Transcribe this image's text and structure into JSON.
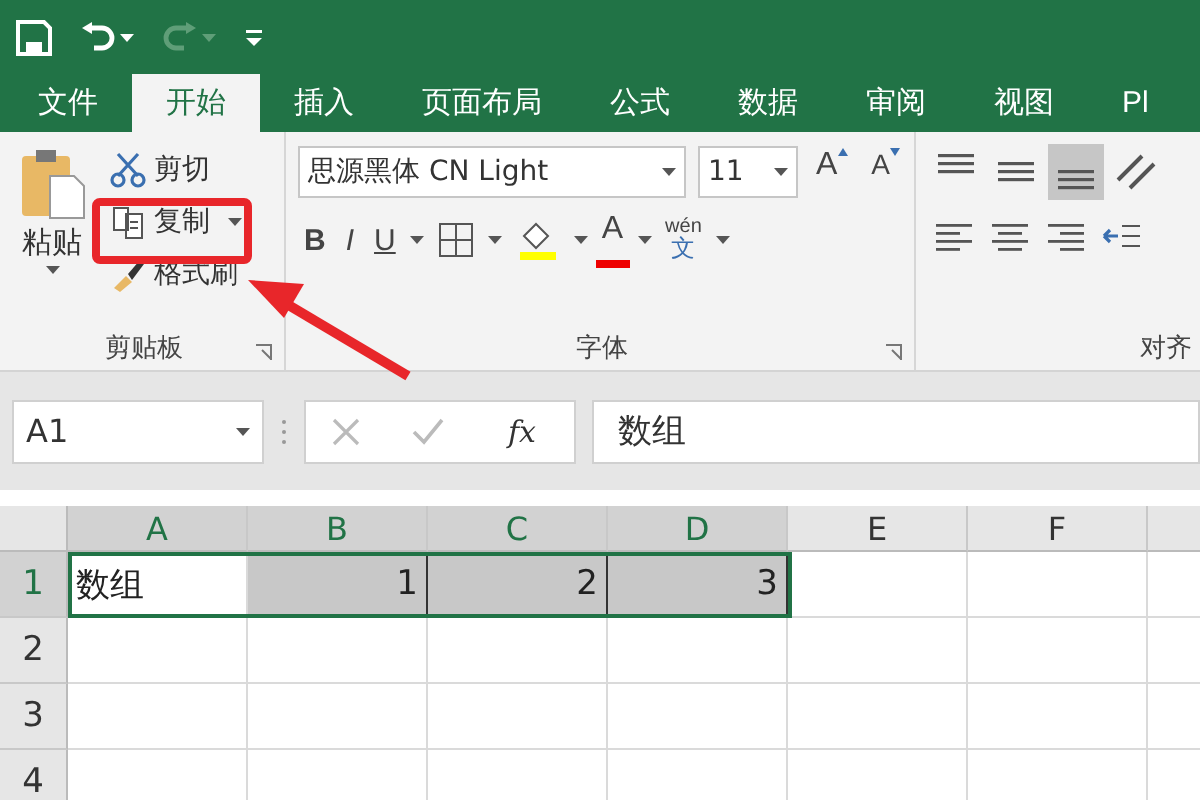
{
  "quick_access": [
    {
      "kind": "save",
      "disabled": false
    },
    {
      "kind": "undo",
      "disabled": false
    },
    {
      "kind": "redo",
      "disabled": true
    },
    {
      "kind": "customize",
      "disabled": false
    }
  ],
  "tabs": [
    {
      "label": "文件",
      "selected": false
    },
    {
      "label": "开始",
      "selected": true
    },
    {
      "label": "插入",
      "selected": false
    },
    {
      "label": "页面布局",
      "selected": false
    },
    {
      "label": "公式",
      "selected": false
    },
    {
      "label": "数据",
      "selected": false
    },
    {
      "label": "审阅",
      "selected": false
    },
    {
      "label": "视图",
      "selected": false
    },
    {
      "label": "Pl",
      "selected": false
    }
  ],
  "clipboard": {
    "title": "剪贴板",
    "paste": "粘贴",
    "cut": "剪切",
    "copy": "复制",
    "format_painter": "格式刷"
  },
  "font": {
    "title": "字体",
    "font_name": "思源黑体 CN Light",
    "font_size": "11",
    "grow": "A",
    "shrink": "A",
    "styles": [
      "B",
      "I",
      "U"
    ],
    "font_color": "A",
    "phonetic_top": "wén",
    "phonetic_char": "文"
  },
  "alignment": {
    "title": "对齐",
    "vertical": [
      {
        "kind": "top",
        "selected": false
      },
      {
        "kind": "middle",
        "selected": false
      },
      {
        "kind": "bottom",
        "selected": true
      }
    ]
  },
  "formula_bar": {
    "name_box": "A1",
    "function_label": "fx",
    "formula": "数组"
  },
  "columns": [
    {
      "label": "A",
      "selected": true
    },
    {
      "label": "B",
      "selected": true
    },
    {
      "label": "C",
      "selected": true
    },
    {
      "label": "D",
      "selected": true
    },
    {
      "label": "E",
      "selected": false
    },
    {
      "label": "F",
      "selected": false
    }
  ],
  "rows": [
    {
      "label": "1",
      "selected": true,
      "cells": [
        {
          "value": "数组",
          "kind": "text",
          "selected": false
        },
        {
          "value": "1",
          "kind": "number",
          "selected": true
        },
        {
          "value": "2",
          "kind": "number",
          "selected": true
        },
        {
          "value": "3",
          "kind": "number",
          "selected": true
        }
      ]
    },
    {
      "label": "2",
      "selected": false,
      "cells": []
    },
    {
      "label": "3",
      "selected": false,
      "cells": []
    },
    {
      "label": "4",
      "selected": false,
      "cells": []
    }
  ]
}
